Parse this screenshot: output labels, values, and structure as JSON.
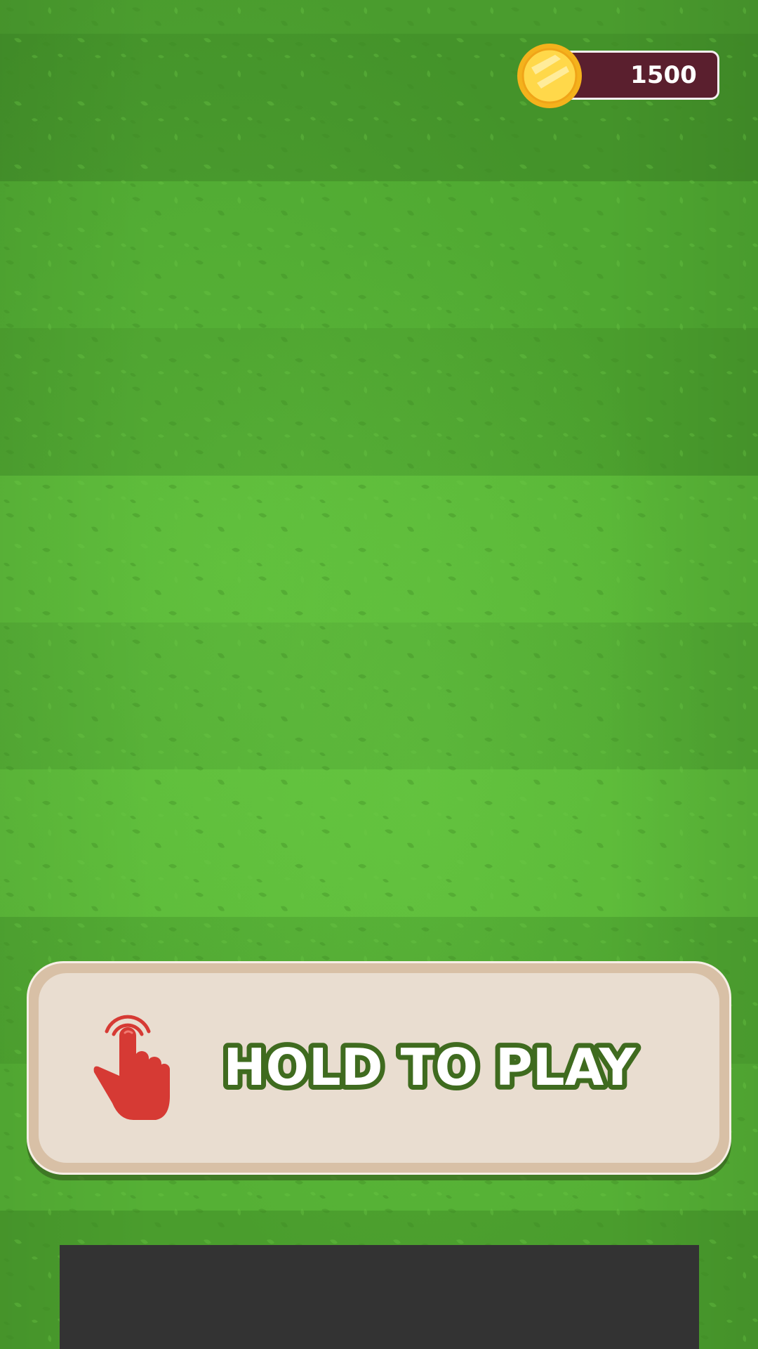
{
  "hud": {
    "coins": "1500",
    "coin_icon": "gold-coin-icon"
  },
  "start_prompt": {
    "label": "HOLD TO PLAY",
    "icon": "tap-hand-icon",
    "label_fill": "#ffffff",
    "label_outline": "#3f6b1f"
  },
  "colors": {
    "grass_light": "#5fbf3a",
    "grass_dark": "#4a9e2c",
    "coin_bar": "#5a1f2e",
    "panel_border": "#d8c0a6",
    "panel_fill": "#e9ddd0",
    "hand": "#d63a34",
    "banner": "#333333"
  }
}
